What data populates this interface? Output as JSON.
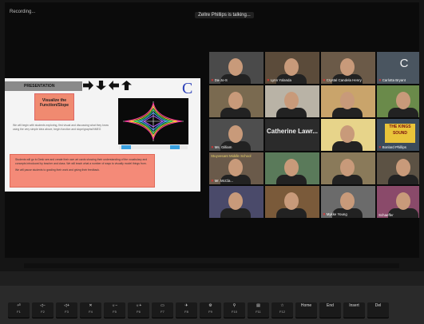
{
  "topbar": {
    "recording": "Recording...",
    "talking": "Zellre Phillips is talking..."
  },
  "slide": {
    "header": "PRESENTATION",
    "logo": "C",
    "visual_box": "Visualize the Function/Slope",
    "body_text": "We will begin with students exploring, first visual and discussing what they know using the very simple idea above, begin function and slope/graphs/NMEG",
    "notes_text": "Students will go to Desk see and create their own art cards showing their understanding of the vocabulary and concepts introduced by teacher and class. We will teach what a number of ways to visually model things from.",
    "notes_text2": "We will pause students to grading their work and giving their feedback."
  },
  "gallery": {
    "tiles": [
      {
        "label": "Da-Jo-S",
        "muted": true
      },
      {
        "label": "Lynn Yolanda",
        "muted": true
      },
      {
        "label": "Crystal Candela Henry",
        "muted": true
      },
      {
        "label": "Carlotta Bryant",
        "muted": true,
        "initial": "C"
      },
      {
        "label": "",
        "muted": false
      },
      {
        "label": "",
        "muted": false
      },
      {
        "label": "",
        "muted": false
      },
      {
        "label": "",
        "muted": false
      },
      {
        "label": "Ms. Gilliam",
        "muted": true
      },
      {
        "label": "",
        "muted": false,
        "big": "Catherine  Lawr..."
      },
      {
        "label": "",
        "muted": false
      },
      {
        "label": "Bonlard Phillips",
        "muted": true
      },
      {
        "label": "Mr. McCla...",
        "muted": true
      },
      {
        "label": "",
        "muted": false
      },
      {
        "label": "",
        "muted": false
      },
      {
        "label": "",
        "muted": false
      },
      {
        "label": "",
        "muted": false
      },
      {
        "label": "",
        "muted": false
      },
      {
        "label": "Mykke Young",
        "muted": true
      },
      {
        "label": "Schaeffer",
        "muted": false
      }
    ],
    "kings_text": "THE KINGS SOUND",
    "school_tag": "Stuyvesant Middle School"
  },
  "keyboard": {
    "keys": [
      {
        "top": "⏎",
        "sub": "F1"
      },
      {
        "top": "◁−",
        "sub": "F2"
      },
      {
        "top": "◁+",
        "sub": "F3"
      },
      {
        "top": "✕",
        "sub": "F4"
      },
      {
        "top": "☼−",
        "sub": "F5"
      },
      {
        "top": "☼+",
        "sub": "F6"
      },
      {
        "top": "▭",
        "sub": "F7"
      },
      {
        "top": "✈",
        "sub": "F8"
      },
      {
        "top": "⚙",
        "sub": "F9"
      },
      {
        "top": "⚲",
        "sub": "F10"
      },
      {
        "top": "▤",
        "sub": "F11"
      },
      {
        "top": "☆",
        "sub": "F12"
      },
      {
        "top": "Home",
        "sub": ""
      },
      {
        "top": "End",
        "sub": ""
      },
      {
        "top": "Insert",
        "sub": ""
      },
      {
        "top": "Del",
        "sub": ""
      }
    ]
  }
}
